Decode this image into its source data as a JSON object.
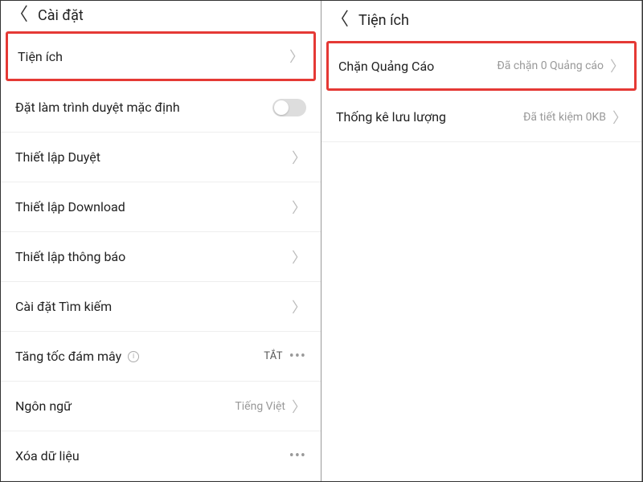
{
  "left": {
    "title": "Cài đặt",
    "items": [
      {
        "label": "Tiện ích",
        "type": "nav",
        "highlighted": true
      },
      {
        "label": "Đặt làm trình duyệt mặc định",
        "type": "toggle",
        "on": false
      },
      {
        "label": "Thiết lập Duyệt",
        "type": "nav"
      },
      {
        "label": "Thiết lập Download",
        "type": "nav"
      },
      {
        "label": "Thiết lập thông báo",
        "type": "nav"
      },
      {
        "label": "Cài đặt Tìm kiếm",
        "type": "nav"
      },
      {
        "label": "Tăng tốc đám mây",
        "type": "info-dots",
        "value": "TẮT"
      },
      {
        "label": "Ngôn ngữ",
        "type": "nav-value",
        "value": "Tiếng Việt"
      },
      {
        "label": "Xóa dữ liệu",
        "type": "dots"
      }
    ]
  },
  "right": {
    "title": "Tiện ích",
    "items": [
      {
        "label": "Chặn Quảng Cáo",
        "type": "nav-value",
        "value": "Đã chặn 0 Quảng cáo",
        "highlighted": true
      },
      {
        "label": "Thống kê lưu lượng",
        "type": "nav-value",
        "value": "Đã tiết kiệm 0KB"
      }
    ]
  }
}
